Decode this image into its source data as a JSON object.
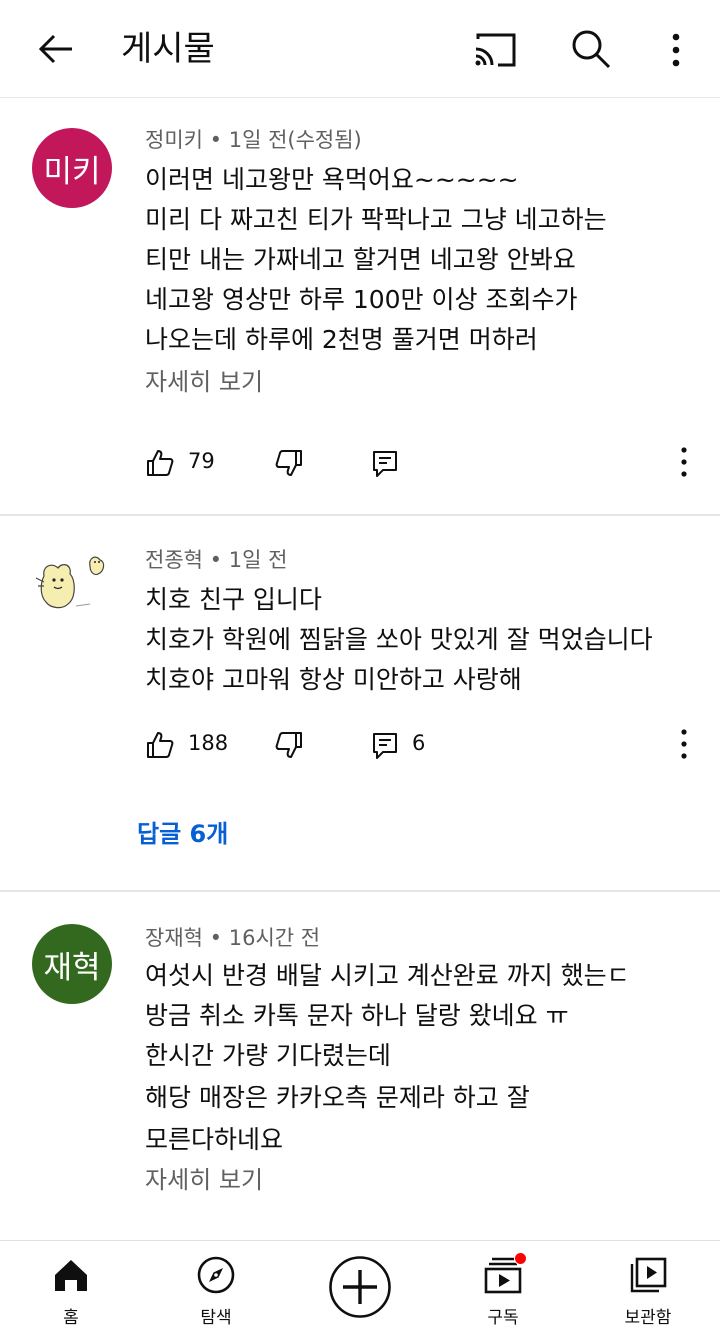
{
  "header": {
    "title": "게시물"
  },
  "comments": [
    {
      "avatar_text": "미키",
      "avatar_color": "#c2185b",
      "author": "정미키",
      "time": "1일 전(수정됨)",
      "lines": [
        "이러면 네고왕만 욕먹어요~~~~~",
        "미리 다 짜고친 티가 팍팍나고 그냥 네고하는",
        "티만 내는 가짜네고 할거면 네고왕 안봐요",
        "네고왕 영상만 하루 100만 이상 조회수가",
        "나오는데 하루에 2천명 풀거면 머하러"
      ],
      "read_more": "자세히 보기",
      "likes": "79",
      "reply_count": ""
    },
    {
      "avatar_text": "",
      "author": "전종혁",
      "time": "1일 전",
      "lines": [
        "치호 친구 입니다",
        "치호가 학원에 찜닭을 쏘아 맛있게 잘 먹었습니다",
        "치호야 고마워 항상 미안하고 사랑해"
      ],
      "read_more": "",
      "likes": "188",
      "reply_count": "6",
      "replies_link": "답글 6개"
    },
    {
      "avatar_text": "재혁",
      "avatar_color": "#33691e",
      "author": "장재혁",
      "time": "16시간 전",
      "lines": [
        "여섯시 반경 배달 시키고 계산완료 까지 했는ㄷ",
        "방금 취소 카톡 문자 하나 달랑 왔네요 ㅠ",
        "한시간 가량 기다렸는데",
        "해당 매장은 카카오측 문제라 하고 잘",
        "모른다하네요"
      ],
      "read_more": "자세히 보기"
    }
  ],
  "nav": {
    "home": "홈",
    "explore": "탐색",
    "subscriptions": "구독",
    "library": "보관함"
  },
  "icons": {
    "header": [
      "back-arrow-icon",
      "cast-icon",
      "search-icon",
      "more-vert-icon"
    ],
    "actions": [
      "thumb-up-icon",
      "thumb-down-icon",
      "reply-icon",
      "more-vert-icon"
    ],
    "nav": [
      "home-icon",
      "compass-icon",
      "create-plus-icon",
      "subscriptions-icon",
      "library-icon"
    ]
  },
  "colors": {
    "link": "#065fd4",
    "notification_dot": "#ff0000"
  }
}
